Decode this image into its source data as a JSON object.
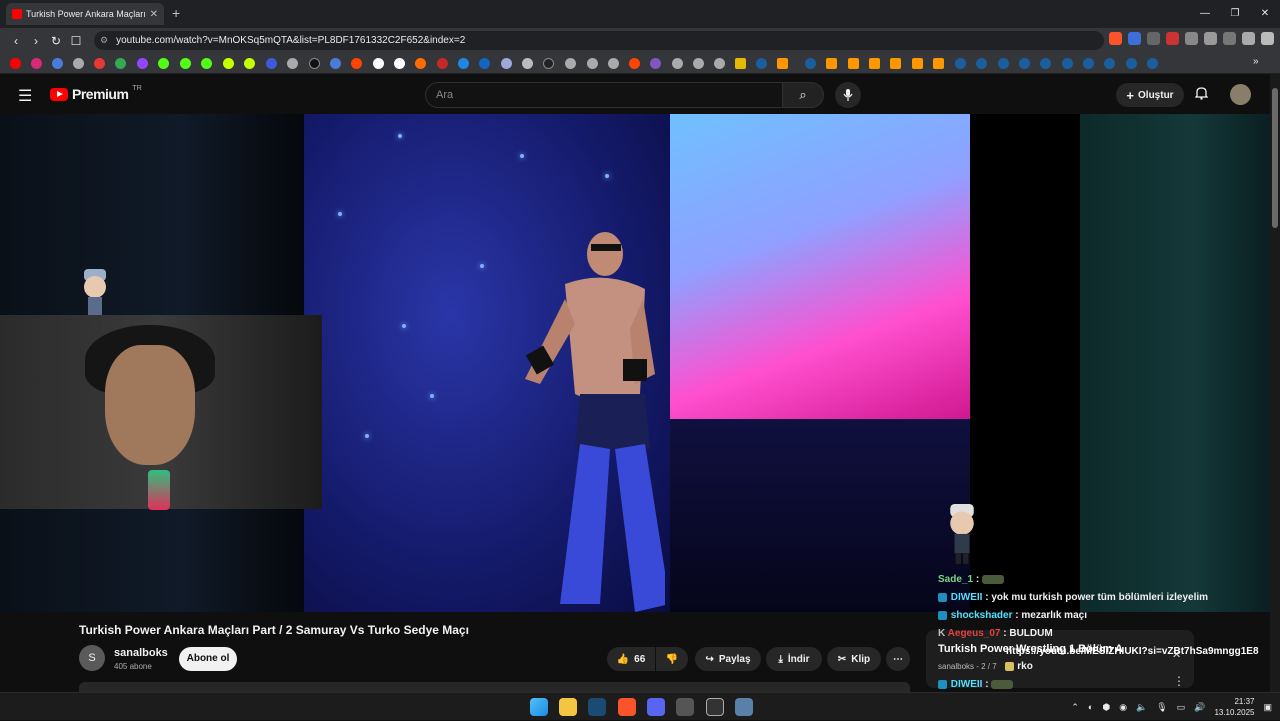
{
  "browser": {
    "tab_title": "Turkish Power Ankara Maçları",
    "tab_close": "✕",
    "new_tab": "+",
    "window_controls": [
      "—",
      "❐",
      "✕"
    ],
    "url": "youtube.com/watch?v=MnOKSq5mQTA&list=PL8DF1761332C2F652&index=2",
    "nav": [
      "‹",
      "›",
      "↻",
      "☐"
    ]
  },
  "youtube": {
    "logo_text": "Premium",
    "logo_region": "TR",
    "search_placeholder": "Ara",
    "create_label": "Oluştur",
    "menu_icon": "☰",
    "search_icon": "⌕",
    "mic_icon": "🎙",
    "bell_icon": "🔔"
  },
  "video": {
    "title": "Turkish Power Ankara Maçları Part / 2 Samuray Vs Turko Sedye Maçı",
    "channel_initial": "S",
    "channel": "sanalboks",
    "subscribers": "405 abone",
    "subscribe_label": "Abone ol",
    "likes": "66",
    "share_label": "Paylaş",
    "download_label": "İndir",
    "clip_label": "Klip",
    "more_label": "⋯"
  },
  "chat": [
    {
      "user": "Sade_1",
      "msg": "",
      "color": "#7fd48a",
      "badge": "#3b8b3b"
    },
    {
      "user": "DIWEII",
      "msg": "yok mu turkish power tüm bölümleri izleyelim",
      "color": "#4fe0ff",
      "badge": "#1f8fbf"
    },
    {
      "user": "shockshader",
      "msg": "mezarlık maçı",
      "color": "#4fe0ff",
      "badge": "#1f8fbf"
    },
    {
      "user": "Aegeus_07",
      "msg": "BULDUM",
      "color": "#e04040",
      "badge": "#555"
    },
    {
      "user": "Turkish Power Wrestling 1.Bölüm A",
      "msg": "https://youtu.be/MESIZHIUKI?si=vZBt7hSa9mngg1E8",
      "color": "#ffffff",
      "badge": ""
    },
    {
      "user": "sanalboks - 2 / 7",
      "msg": "rko",
      "color": "#bbbbbb",
      "badge": ""
    },
    {
      "user": "DIWEII",
      "msg": "",
      "color": "#4fe0ff",
      "badge": "#1f8fbf"
    }
  ],
  "taskbar": {
    "clock_time": "21:37",
    "clock_date": "13.10.2025"
  }
}
